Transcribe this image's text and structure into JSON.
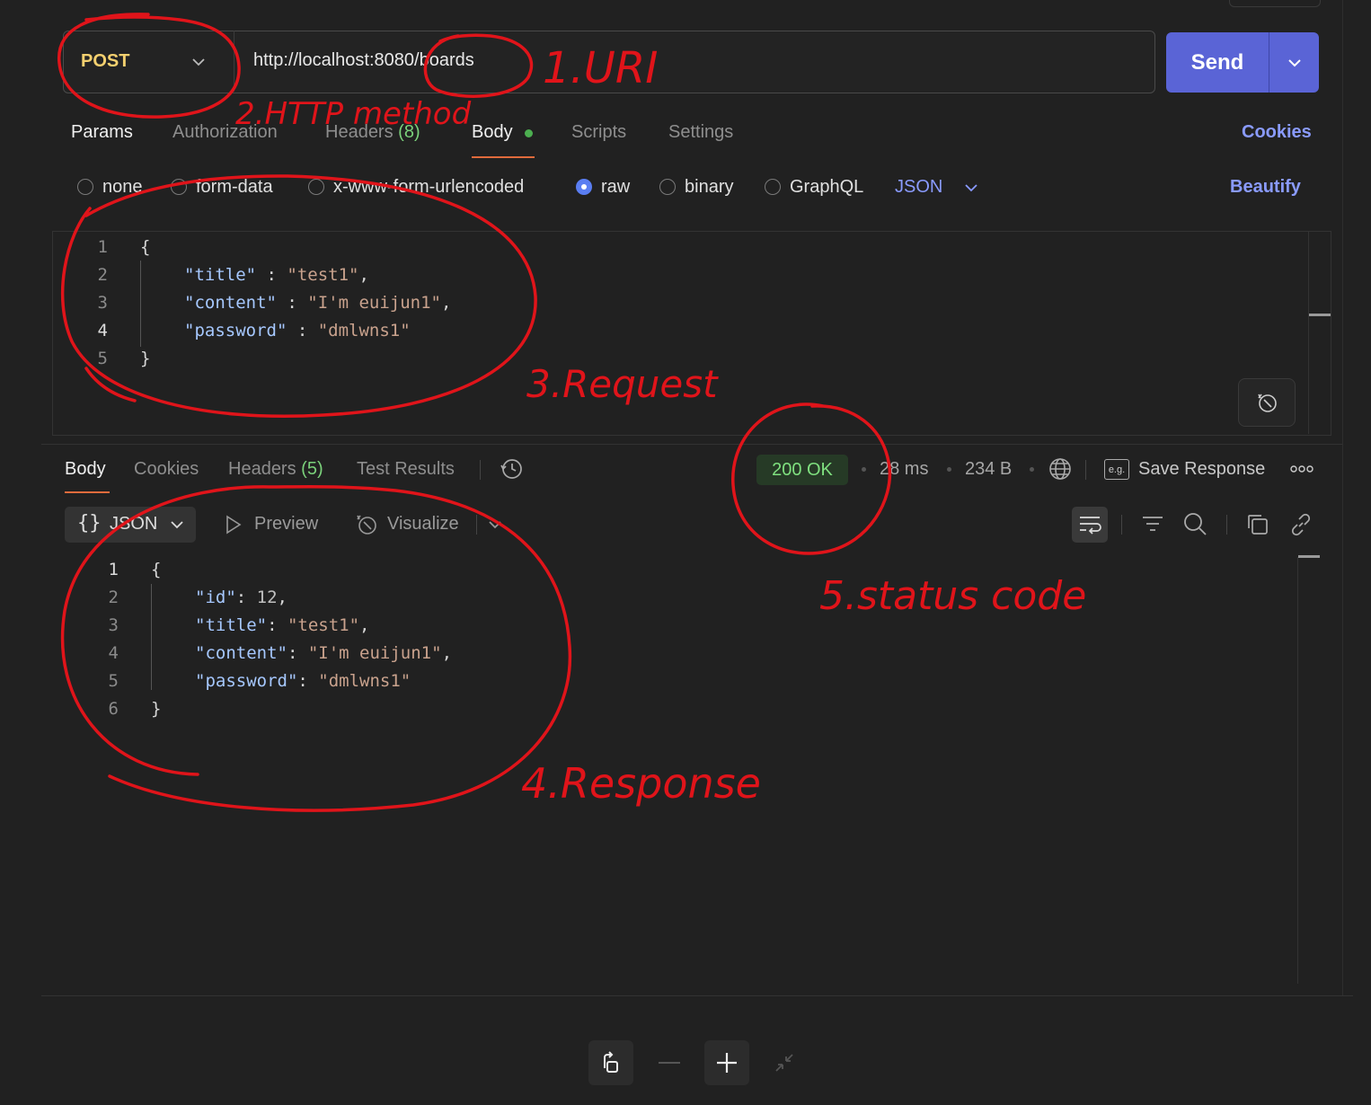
{
  "request": {
    "method": "POST",
    "url": "http://localhost:8080/boards",
    "send_label": "Send",
    "tabs": [
      {
        "label": "Params"
      },
      {
        "label": "Authorization"
      },
      {
        "label": "Headers",
        "count": "(8)"
      },
      {
        "label": "Body"
      },
      {
        "label": "Scripts"
      },
      {
        "label": "Settings"
      }
    ],
    "cookies_link": "Cookies",
    "body_types": [
      {
        "label": "none"
      },
      {
        "label": "form-data"
      },
      {
        "label": "x-www-form-urlencoded"
      },
      {
        "label": "raw"
      },
      {
        "label": "binary"
      },
      {
        "label": "GraphQL"
      }
    ],
    "format": "JSON",
    "beautify_label": "Beautify",
    "line_numbers": [
      "1",
      "2",
      "3",
      "4",
      "5"
    ],
    "body_code": {
      "open": "{",
      "title_key": "\"title\"",
      "title_val": "\"test1\"",
      "content_key": "\"content\"",
      "content_val": "\"I'm euijun1\"",
      "password_key": "\"password\"",
      "password_val": "\"dmlwns1\"",
      "close": "}"
    }
  },
  "response": {
    "tabs": [
      {
        "label": "Body"
      },
      {
        "label": "Cookies"
      },
      {
        "label": "Headers",
        "count": "(5)"
      },
      {
        "label": "Test Results"
      }
    ],
    "status": "200 OK",
    "time": "28 ms",
    "size": "234 B",
    "save_label": "Save Response",
    "eg_label": "e.g.",
    "format_label": "JSON",
    "format_braces": "{}",
    "preview_label": "Preview",
    "visualize_label": "Visualize",
    "line_numbers": [
      "1",
      "2",
      "3",
      "4",
      "5",
      "6"
    ],
    "body_code": {
      "open": "{",
      "id_key": "\"id\"",
      "id_val": "12",
      "title_key": "\"title\"",
      "title_val": "\"test1\"",
      "content_key": "\"content\"",
      "content_val": "\"I'm euijun1\"",
      "password_key": "\"password\"",
      "password_val": "\"dmlwns1\"",
      "close": "}"
    }
  },
  "annotations": {
    "uri": "1.URI",
    "method": "2.HTTP method",
    "request": "3.Request",
    "response": "4.Response",
    "status": "5.status code"
  },
  "icons": [
    "chevron-down-icon",
    "history-icon",
    "globe-icon",
    "more-icon",
    "wrap-icon",
    "filter-icon",
    "search-icon",
    "copy-icon",
    "link-icon",
    "visualize-icon",
    "reset-icon",
    "minus-icon",
    "plus-icon",
    "collapse-icon"
  ],
  "colors": {
    "accent": "#5a64d6",
    "method": "#f4d06f",
    "status_ok": "#7fe07f",
    "annotation": "#e0141a",
    "link": "#8a9bff"
  }
}
